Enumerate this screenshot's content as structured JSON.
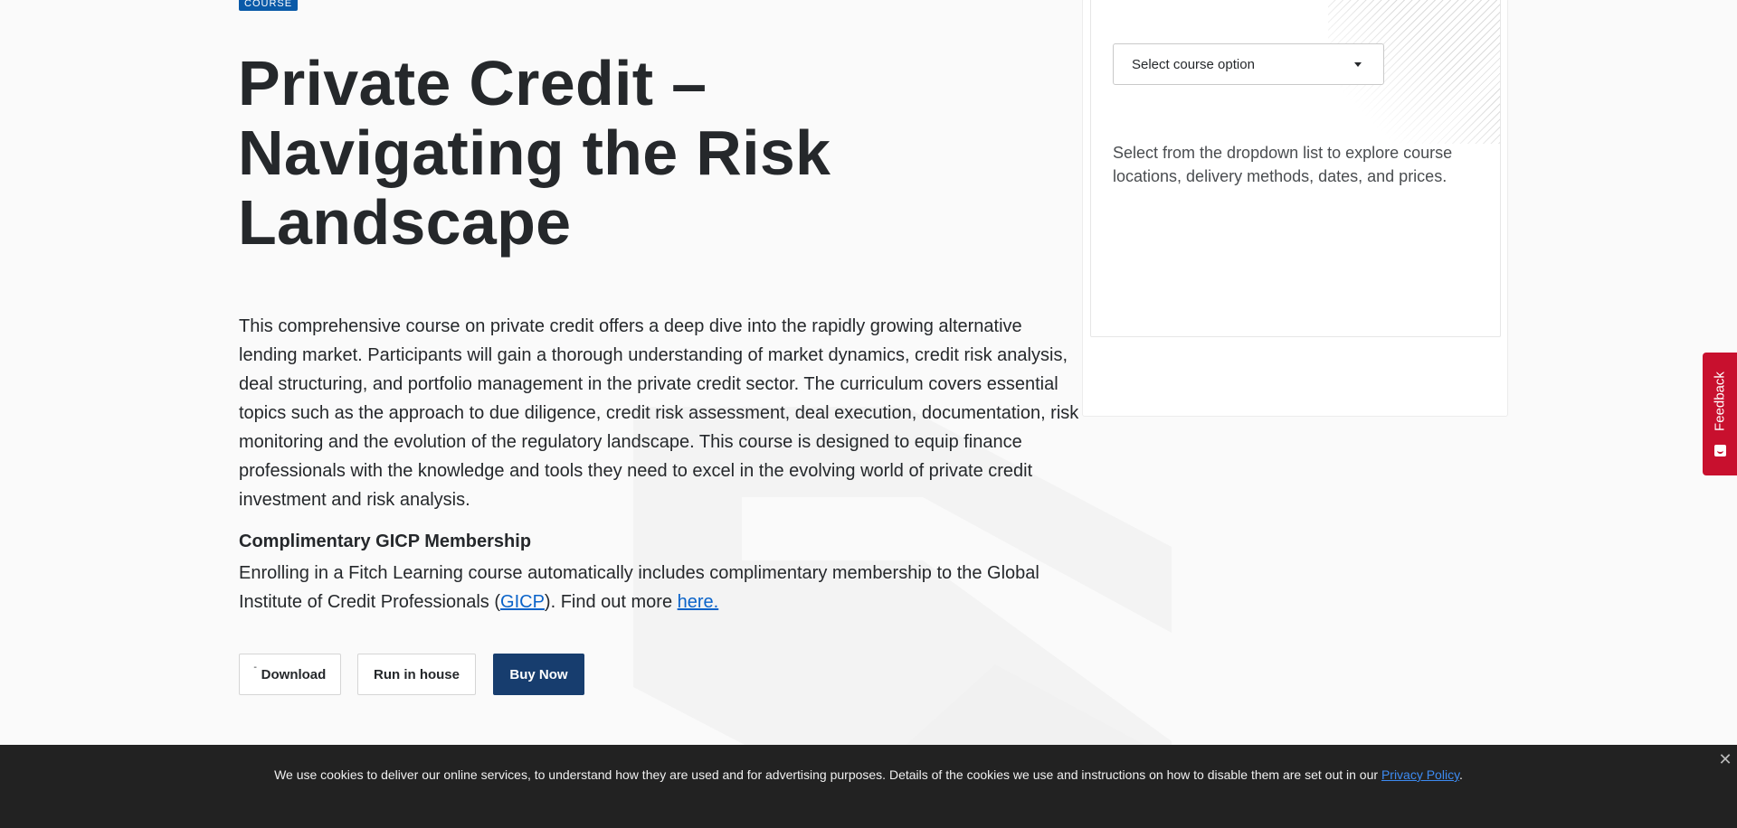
{
  "badge": "Course",
  "title": "Private Credit – Navigating the Risk Landscape",
  "description": "This comprehensive course on private credit offers a deep dive into the rapidly growing alternative lending market. Participants will gain a thorough understanding of market dynamics, credit risk analysis, deal structuring, and portfolio management in the private credit sector. The curriculum covers essential topics such as the approach to due diligence, credit risk assessment, deal execution, documentation, risk monitoring and the evolution of the regulatory landscape. This course is designed to equip finance professionals with the knowledge and tools they need to excel in the evolving world of private credit investment and risk analysis.",
  "gicp": {
    "heading": "Complimentary GICP Membership",
    "text_before": "Enrolling in a Fitch Learning course automatically includes complimentary membership to the Global Institute of Credit Professionals (",
    "gicp_link": "GICP",
    "text_middle": "). Find out more ",
    "here_link": "here."
  },
  "buttons": {
    "download": "Download",
    "run_in_house": "Run in house",
    "buy_now": "Buy Now"
  },
  "panel": {
    "select_label": "Select course option",
    "help_text": "Select from the dropdown list to explore course locations, delivery methods, dates, and prices."
  },
  "feedback": {
    "label": "Feedback",
    "color": "#c8102e"
  },
  "cookie": {
    "text": "We use cookies to deliver our online services, to understand how they are used and for advertising purposes. Details of the cookies we use and instructions on how to disable them are set out in our ",
    "link": "Privacy Policy",
    "suffix": "."
  },
  "colors": {
    "accent": "#0a5aa8",
    "primary_button": "#173d6e",
    "link": "#0a63c9"
  }
}
